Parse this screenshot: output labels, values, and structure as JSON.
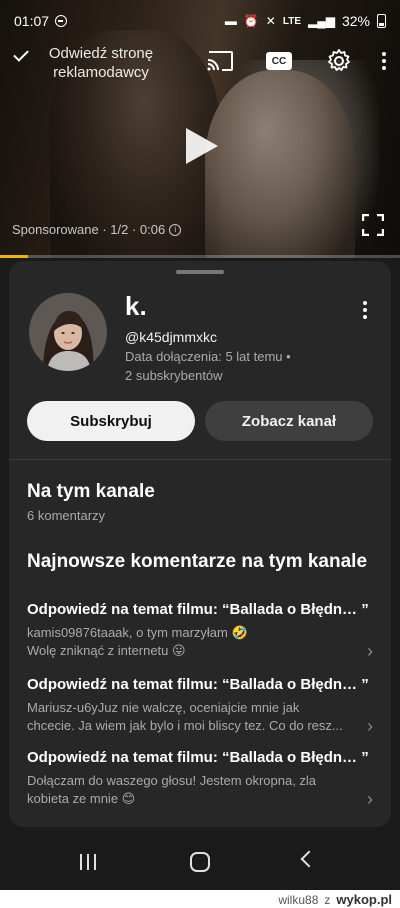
{
  "status_bar": {
    "time": "01:07",
    "network": "LTE",
    "battery": "32%"
  },
  "video": {
    "visit_advertiser": "Odwiedź stronę reklamodawcy",
    "cc_label": "CC",
    "ad_meta": "Sponsorowane · 1/2 · 0:06",
    "progress_fraction": 0.07
  },
  "channel": {
    "name": "k.",
    "handle": "@k45djmmxkc",
    "joined": "Data dołączenia: 5 lat temu •",
    "subscribers": "2 subskrybentów"
  },
  "buttons": {
    "subscribe": "Subskrybuj",
    "view_channel": "Zobacz kanał"
  },
  "on_channel": {
    "title": "Na tym kanale",
    "count": "6 komentarzy"
  },
  "latest": {
    "title": "Najnowsze komentarze na tym kanale",
    "comments": [
      {
        "title": "Odpowiedź na temat filmu: “Ballada o Błędn… ”",
        "line1": "kamis09876taaak, o tym marzyłam 🤣",
        "line2": "Wolę zniknąć z internetu 😛"
      },
      {
        "title": "Odpowiedź na temat filmu: “Ballada o Błędn… ”",
        "line1": "Mariusz-u6yJuz nie walczę,  oceniajcie mnie jak",
        "line2": "chcecie. Ja wiem jak bylo i moi bliscy tez. Co do resz..."
      },
      {
        "title": "Odpowiedź na temat filmu: “Ballada o Błędn… ”",
        "line1": "Dołączam do waszego głosu! Jestem okropna, zla",
        "line2": "kobieta ze mnie 😊"
      }
    ]
  },
  "watermark": {
    "user": "wilku88",
    "separator": "z",
    "site": "wykop.pl"
  }
}
